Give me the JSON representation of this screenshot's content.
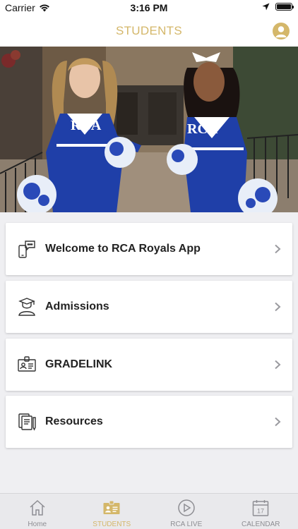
{
  "status_bar": {
    "carrier": "Carrier",
    "time": "3:16 PM"
  },
  "nav": {
    "title": "STUDENTS"
  },
  "hero": {
    "jersey_text_left": "RCA",
    "jersey_text_right": "RCA"
  },
  "menu": {
    "items": [
      {
        "label": "Welcome to RCA Royals App",
        "icon": "chat-phone-icon"
      },
      {
        "label": "Admissions",
        "icon": "graduate-icon"
      },
      {
        "label": "GRADELINK",
        "icon": "id-card-icon"
      },
      {
        "label": "Resources",
        "icon": "documents-icon"
      }
    ]
  },
  "tab_bar": {
    "tabs": [
      {
        "label": "Home",
        "icon": "home-icon",
        "active": false
      },
      {
        "label": "STUDENTS",
        "icon": "id-badge-icon",
        "active": true
      },
      {
        "label": "RCA LIVE",
        "icon": "play-circle-icon",
        "active": false
      },
      {
        "label": "CALENDAR",
        "icon": "calendar-icon",
        "active": false,
        "calendar_day": "17"
      }
    ]
  },
  "colors": {
    "accent": "#d4b76a",
    "inactive": "#8e8e93",
    "background": "#efeff2"
  }
}
